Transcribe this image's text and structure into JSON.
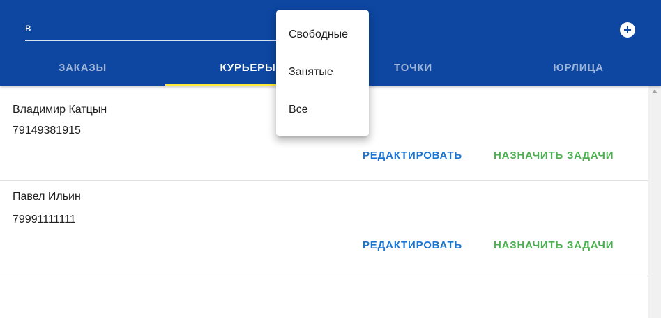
{
  "search": {
    "value": "в",
    "placeholder": ""
  },
  "header": {
    "add_icon": "plus-circle-icon"
  },
  "tabs": [
    {
      "label": "Заказы",
      "active": false
    },
    {
      "label": "Курьеры",
      "active": true
    },
    {
      "label": "Точки",
      "active": false
    },
    {
      "label": "Юрлица",
      "active": false
    }
  ],
  "dropdown": {
    "items": [
      {
        "label": "Свободные"
      },
      {
        "label": "Занятые"
      },
      {
        "label": "Все"
      }
    ]
  },
  "couriers": [
    {
      "name": "Владимир Катцын",
      "phone": "79149381915",
      "edit_label": "Редактировать",
      "assign_label": "Назначить задачи"
    },
    {
      "name": "Павел Ильин",
      "phone": "79991111111",
      "edit_label": "Редактировать",
      "assign_label": "Назначить задачи"
    }
  ],
  "colors": {
    "header_bg": "#0d47a1",
    "tab_indicator": "#ffeb3b",
    "edit_button": "#1976d2",
    "assign_button": "#4caf50"
  }
}
